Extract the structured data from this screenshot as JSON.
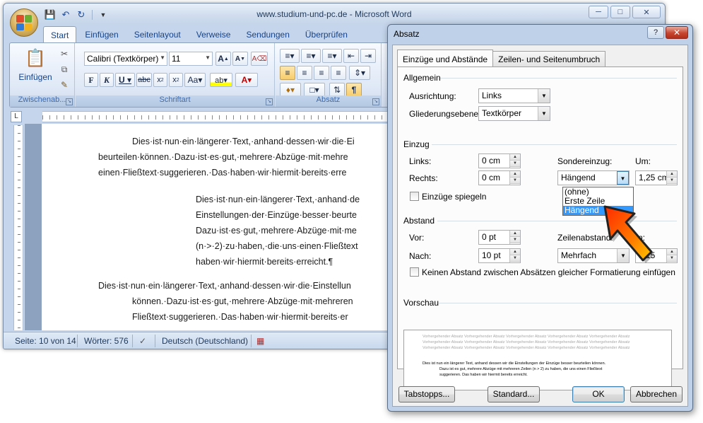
{
  "word": {
    "title": "www.studium-und-pc.de - Microsoft Word",
    "tabs": [
      "Start",
      "Einfügen",
      "Seitenlayout",
      "Verweise",
      "Sendungen",
      "Überprüfen"
    ],
    "ribbon": {
      "clipboard": {
        "paste_label": "Einfügen",
        "group_label": "Zwischenab..."
      },
      "font": {
        "font_name": "Calibri (Textkörper)",
        "font_size": "11",
        "group_label": "Schriftart"
      },
      "paragraph": {
        "group_label": "Absatz"
      }
    },
    "document": {
      "paragraphs": [
        "Dies·ist·nun·ein·längerer·Text,·anhand·dessen·wir·die·Ei",
        "beurteilen·können.·Dazu·ist·es·gut,·mehrere·Abzüge·mit·mehre",
        "einen·Fließtext·suggerieren.·Das·haben·wir·hiermit·bereits·erre",
        "Dies·ist·nun·ein·längerer·Text,·anhand·de",
        "Einstellungen·der·Einzüge·besser·beurte",
        "Dazu·ist·es·gut,·mehrere·Abzüge·mit·me",
        "(n·>·2)·zu·haben,·die·uns·einen·Fließtext",
        "haben·wir·hiermit·bereits·erreicht.¶",
        "Dies·ist·nun·ein·längerer·Text,·anhand·dessen·wir·die·Einstellun",
        "können.·Dazu·ist·es·gut,·mehrere·Abzüge·mit·mehreren",
        "Fließtext·suggerieren.·Das·haben·wir·hiermit·bereits·er"
      ]
    },
    "status": {
      "page": "Seite: 10 von 14",
      "words": "Wörter: 576",
      "language": "Deutsch (Deutschland)"
    }
  },
  "dialog": {
    "title": "Absatz",
    "tabs": [
      "Einzüge und Abstände",
      "Zeilen- und Seitenumbruch"
    ],
    "allgemein": {
      "heading": "Allgemein",
      "alignment_label": "Ausrichtung:",
      "alignment_value": "Links",
      "outline_label": "Gliederungsebene:",
      "outline_value": "Textkörper"
    },
    "einzug": {
      "heading": "Einzug",
      "left_label": "Links:",
      "left_value": "0 cm",
      "right_label": "Rechts:",
      "right_value": "0 cm",
      "special_label": "Sondereinzug:",
      "special_value": "Hängend",
      "by_label": "Um:",
      "by_value": "1,25 cm",
      "mirror_label": "Einzüge spiegeln",
      "special_options": [
        "(ohne)",
        "Erste Zeile",
        "Hängend"
      ]
    },
    "abstand": {
      "heading": "Abstand",
      "before_label": "Vor:",
      "before_value": "0 pt",
      "after_label": "Nach:",
      "after_value": "10 pt",
      "line_spacing_label": "Zeilenabstand:",
      "line_spacing_value": "Mehrfach",
      "at_label": "n:",
      "at_value": "1,15",
      "no_space_label": "Keinen Abstand zwischen Absätzen gleicher Formatierung einfügen"
    },
    "vorschau": {
      "heading": "Vorschau",
      "grey_line": "Vorhergehender Absatz Vorhergehender Absatz Vorhergehender Absatz Vorhergehender Absatz Vorhergehender Absatz",
      "sample_lines": [
        "Dies ist nun ein längerer Text, anhand dessen wir die Einstellungen der Einzüge besser beurteilen können.",
        "Dazu ist es gut, mehrere Abzüge mit mehreren Zeilen (n > 2) zu haben, die uns einen Fließtext",
        "suggerieren. Das haben wir hiermit bereits erreicht."
      ]
    },
    "buttons": {
      "tabs": "Tabstopps...",
      "default": "Standard...",
      "ok": "OK",
      "cancel": "Abbrechen"
    }
  }
}
